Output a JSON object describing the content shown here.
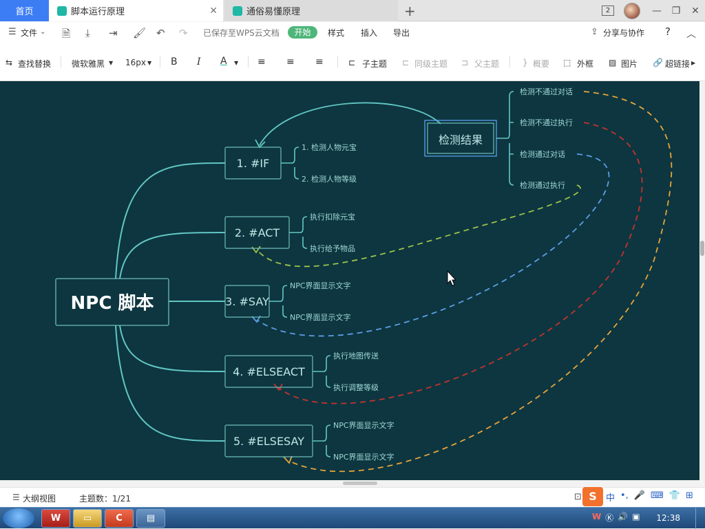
{
  "tabs": {
    "home": "首页",
    "active": "脚本运行原理",
    "inactive": "通俗易懂原理",
    "count": "2"
  },
  "menu": {
    "file": "文件",
    "saved": "已保存至WPS云文档",
    "start": "开始",
    "style": "样式",
    "insert": "插入",
    "export": "导出",
    "share": "分享与协作",
    "help": "?"
  },
  "toolbar": {
    "find_replace": "查找替换",
    "font": "微软雅黑",
    "size": "16px",
    "bold": "B",
    "italic": "I",
    "color": "A",
    "subtopic": "子主题",
    "sibling": "同级主题",
    "parent": "父主题",
    "summary": "概要",
    "frame": "外框",
    "image": "图片",
    "link": "超链接"
  },
  "mindmap": {
    "root": "NPC 脚本",
    "result": "检测结果",
    "nodes": [
      {
        "label": "1. #IF",
        "children": [
          "1. 检测人物元宝",
          "2. 检测人物等级"
        ]
      },
      {
        "label": "2. #ACT",
        "children": [
          "执行扣除元宝",
          "执行给予物品"
        ]
      },
      {
        "label": "3. #SAY",
        "children": [
          "NPC界面显示文字",
          "NPC界面显示文字"
        ]
      },
      {
        "label": "4. #ELSEACT",
        "children": [
          "执行地图传送",
          "执行调整等级"
        ]
      },
      {
        "label": "5. #ELSESAY",
        "children": [
          "NPC界面显示文字",
          "NPC界面显示文字"
        ]
      }
    ],
    "result_children": [
      "检测不通过对话",
      "检测不通过执行",
      "检测通过对话",
      "检测通过执行"
    ],
    "colors": {
      "background": "#0d3640",
      "line": "#62c7c4",
      "node_border": "#6fbdb9",
      "result_border": "#5fa8ff",
      "yellow": "#e8a53a",
      "red": "#c4332e",
      "blue": "#5d9ee8",
      "green": "#9fc24a"
    }
  },
  "status": {
    "outline": "大纲视图",
    "topic_count": "主题数：1/21"
  },
  "taskbar": {
    "clock": "12:38",
    "ime": "中"
  }
}
